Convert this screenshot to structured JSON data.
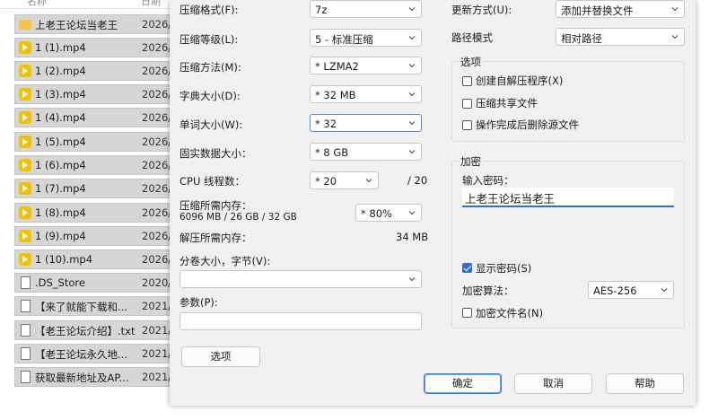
{
  "file_list": {
    "header": {
      "name_col": "名称",
      "date_col": "日期"
    },
    "rows": [
      {
        "icon": "folder-icon",
        "name": "上老王论坛当老王",
        "date": "2026/"
      },
      {
        "icon": "video-icon",
        "name": "1 (1).mp4",
        "date": "2026/"
      },
      {
        "icon": "video-icon",
        "name": "1 (2).mp4",
        "date": "2026/"
      },
      {
        "icon": "video-icon",
        "name": "1 (3).mp4",
        "date": "2026/"
      },
      {
        "icon": "video-icon",
        "name": "1 (4).mp4",
        "date": "2026/"
      },
      {
        "icon": "video-icon",
        "name": "1 (5).mp4",
        "date": "2026/"
      },
      {
        "icon": "video-icon",
        "name": "1 (6).mp4",
        "date": "2026/"
      },
      {
        "icon": "video-icon",
        "name": "1 (7).mp4",
        "date": "2026/"
      },
      {
        "icon": "video-icon",
        "name": "1 (8).mp4",
        "date": "2026/"
      },
      {
        "icon": "video-icon",
        "name": "1 (9).mp4",
        "date": "2026/"
      },
      {
        "icon": "video-icon",
        "name": "1 (10).mp4",
        "date": "2026/"
      },
      {
        "icon": "document-icon",
        "name": ".DS_Store",
        "date": "2020/"
      },
      {
        "icon": "document-icon",
        "name": "【来了就能下载和...",
        "date": "2021/"
      },
      {
        "icon": "document-icon",
        "name": "【老王论坛介绍】.txt",
        "date": "2021/"
      },
      {
        "icon": "document-icon",
        "name": "【老王论坛永久地...",
        "date": "2021/"
      },
      {
        "icon": "document-icon",
        "name": "获取最新地址及AP...",
        "date": "2021/"
      }
    ]
  },
  "dialog": {
    "left": {
      "format": {
        "label": "压缩格式(F):",
        "value": "7z"
      },
      "level": {
        "label": "压缩等级(L):",
        "value": "5 - 标准压缩"
      },
      "method": {
        "label": "压缩方法(M):",
        "value": "* LZMA2"
      },
      "dict": {
        "label": "字典大小(D):",
        "value": "* 32 MB"
      },
      "word": {
        "label": "单词大小(W):",
        "value": "* 32"
      },
      "solid": {
        "label": "固实数据大小：",
        "value": "* 8 GB"
      },
      "cpu": {
        "label": "CPU 线程数：",
        "value": "* 20",
        "max": "/ 20"
      },
      "mem_compress": {
        "label": "压缩所需内存：",
        "detail": "6096 MB / 26 GB / 32 GB",
        "value": "* 80%"
      },
      "mem_decompress": {
        "label": "解压所需内存：",
        "value": "34 MB"
      },
      "split": {
        "label": "分卷大小，字节(V):",
        "value": ""
      },
      "params": {
        "label": "参数(P):",
        "value": ""
      },
      "options_button": "选项"
    },
    "right": {
      "update": {
        "label": "更新方式(U):",
        "value": "添加并替换文件"
      },
      "path": {
        "label": "路径模式",
        "value": "相对路径"
      },
      "options": {
        "title": "选项",
        "sfx": {
          "label": "创建自解压程序(X)",
          "checked": false
        },
        "shared": {
          "label": "压缩共享文件",
          "checked": false
        },
        "delete": {
          "label": "操作完成后删除源文件",
          "checked": false
        }
      },
      "encryption": {
        "title": "加密",
        "password_label": "输入密码：",
        "password_value": "上老王论坛当老王",
        "show_password": {
          "label": "显示密码(S)",
          "checked": true
        },
        "method_label": "加密算法：",
        "method_value": "AES-256",
        "encrypt_names": {
          "label": "加密文件名(N)",
          "checked": false
        }
      }
    },
    "buttons": {
      "ok": "确定",
      "cancel": "取消",
      "help": "帮助"
    }
  },
  "colors": {
    "accent": "#2f6fd1",
    "video_icon": "#f2c200",
    "folder_icon": "#f5c542"
  }
}
